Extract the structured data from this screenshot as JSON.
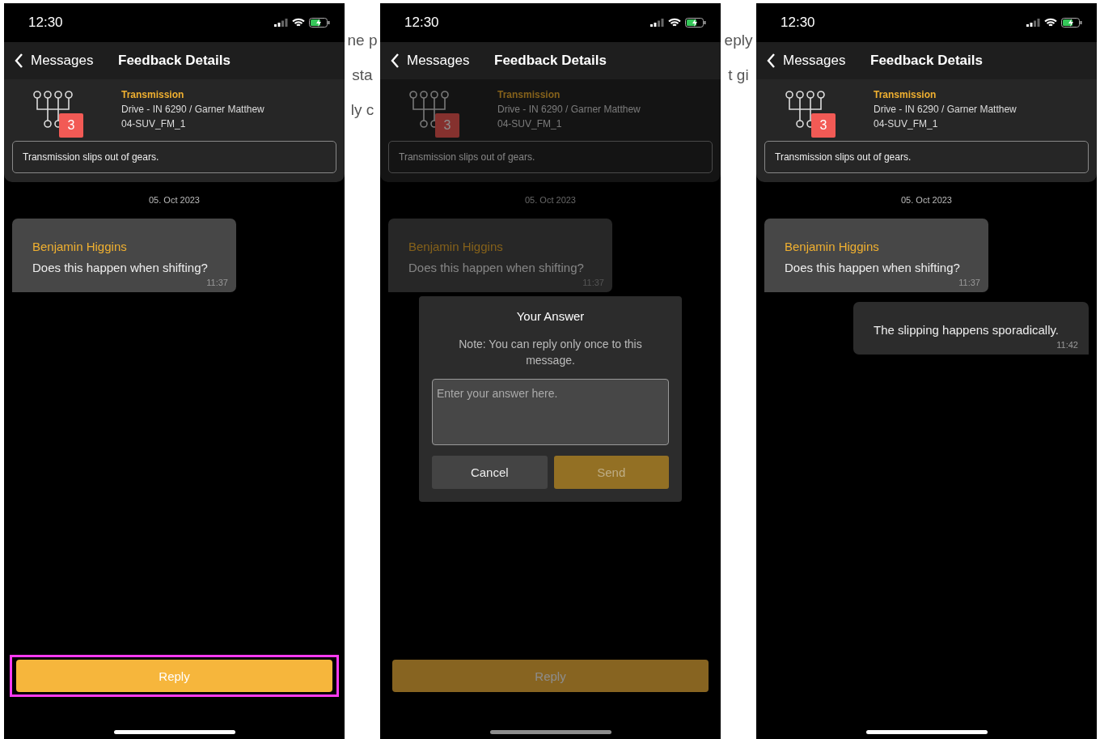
{
  "gaps": [
    {
      "lines": [
        "ne p",
        "sta",
        "ly c"
      ]
    },
    {
      "lines": [
        "eply",
        "t gi"
      ]
    }
  ],
  "screens": [
    {
      "status_time": "12:30",
      "back_label": "Messages",
      "title": "Feedback Details",
      "topic": "Transmission",
      "vehicle": "Drive - IN 6290 / Garner Matthew",
      "code": "04-SUV_FM_1",
      "badge": "3",
      "description": "Transmission slips out of gears.",
      "date": "05. Oct 2023",
      "messages": [
        {
          "kind": "incoming",
          "author": "Benjamin Higgins",
          "text": "Does this happen when shifting?",
          "time": "11:37"
        }
      ],
      "reply_button": {
        "label": "Reply",
        "highlighted": true
      }
    },
    {
      "status_time": "12:30",
      "back_label": "Messages",
      "title": "Feedback Details",
      "topic": "Transmission",
      "vehicle": "Drive - IN 6290 / Garner Matthew",
      "code": "04-SUV_FM_1",
      "badge": "3",
      "description": "Transmission slips out of gears.",
      "date": "05. Oct 2023",
      "messages": [
        {
          "kind": "incoming",
          "author": "Benjamin Higgins",
          "text": "Does this happen when shifting?",
          "time": "11:37"
        }
      ],
      "reply_button": {
        "label": "Reply",
        "highlighted": false
      },
      "dialog": {
        "title": "Your Answer",
        "note": "Note: You can reply only once to this message.",
        "placeholder": "Enter your answer here.",
        "buttons": [
          {
            "label": "Cancel",
            "kind": "secondary"
          },
          {
            "label": "Send",
            "kind": "primary"
          }
        ]
      }
    },
    {
      "status_time": "12:30",
      "back_label": "Messages",
      "title": "Feedback Details",
      "topic": "Transmission",
      "vehicle": "Drive - IN 6290 / Garner Matthew",
      "code": "04-SUV_FM_1",
      "badge": "3",
      "description": "Transmission slips out of gears.",
      "date": "05. Oct 2023",
      "messages": [
        {
          "kind": "incoming",
          "author": "Benjamin Higgins",
          "text": "Does this happen when shifting?",
          "time": "11:37"
        },
        {
          "kind": "outgoing",
          "text": "The slipping happens sporadically.",
          "time": "11:42"
        }
      ]
    }
  ]
}
